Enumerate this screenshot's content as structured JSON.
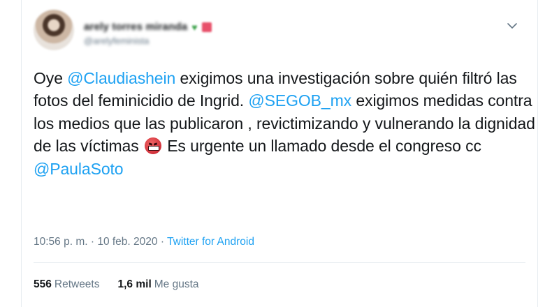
{
  "author": {
    "display_name": "arely torres miranda",
    "handle": "@arelyfeminista"
  },
  "tweet": {
    "segments": [
      {
        "type": "text",
        "value": "Oye "
      },
      {
        "type": "mention",
        "value": "@Claudiashein"
      },
      {
        "type": "text",
        "value": " exigimos una investigación sobre quién filtró las fotos del feminicidio de Ingrid. "
      },
      {
        "type": "mention",
        "value": "@SEGOB_mx"
      },
      {
        "type": "text",
        "value": " exigimos medidas contra los medios que las publicaron , revictimizando y vulnerando la dignidad de las víctimas "
      },
      {
        "type": "emoji",
        "value": "angry-face-icon"
      },
      {
        "type": "text",
        "value": " Es urgente un llamado desde el congreso cc "
      },
      {
        "type": "mention",
        "value": "@PaulaSoto"
      }
    ]
  },
  "meta": {
    "time": "10:56 p. m.",
    "separator": " · ",
    "date": "10 feb. 2020",
    "source": "Twitter for Android"
  },
  "stats": {
    "retweets_count": "556",
    "retweets_label": "Retweets",
    "likes_count": "1,6 mil",
    "likes_label": "Me gusta"
  },
  "colors": {
    "accent": "#1da1f2",
    "text": "#14171a",
    "muted": "#657786"
  }
}
